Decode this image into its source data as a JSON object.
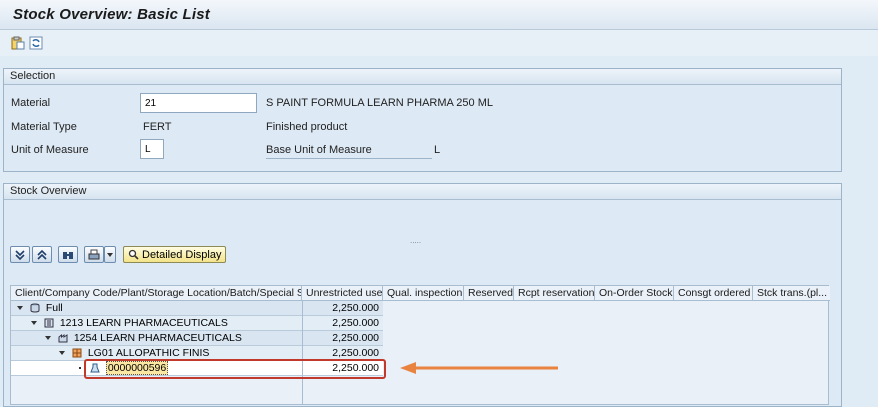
{
  "window": {
    "title": "Stock Overview: Basic List"
  },
  "toolbar": {
    "icons": [
      "clipboard-icon",
      "refresh-icon"
    ]
  },
  "selection": {
    "header": "Selection",
    "material_label": "Material",
    "material_value": "21",
    "material_desc": "S PAINT FORMULA LEARN PHARMA 250 ML",
    "material_type_label": "Material Type",
    "material_type_value": "FERT",
    "material_type_desc": "Finished product",
    "uom_label": "Unit of Measure",
    "uom_value": "L",
    "base_uom_label": "Base Unit of Measure",
    "base_uom_value": "L"
  },
  "stock": {
    "header": "Stock Overview",
    "splitter": ".....",
    "detailed_display_label": "Detailed Display",
    "columns": [
      "Client/Company Code/Plant/Storage Location/Batch/Special Stock",
      "Unrestricted use",
      "Qual. inspection",
      "Reserved",
      "Rcpt reservation",
      "On-Order Stock",
      "Consgt ordered",
      "Stck trans.(pl..."
    ],
    "rows": [
      {
        "label": "Full",
        "value": "2,250.000"
      },
      {
        "label": "1213 LEARN PHARMACEUTICALS",
        "value": "2,250.000"
      },
      {
        "label": "1254 LEARN PHARMACEUTICALS",
        "value": "2,250.000"
      },
      {
        "label": "LG01 ALLOPATHIC FINIS",
        "value": "2,250.000"
      },
      {
        "label": "0000000596",
        "value": "2,250.000"
      }
    ]
  },
  "annotation": {
    "highlight_color": "#c0392b",
    "arrow_color": "#e8843f"
  }
}
